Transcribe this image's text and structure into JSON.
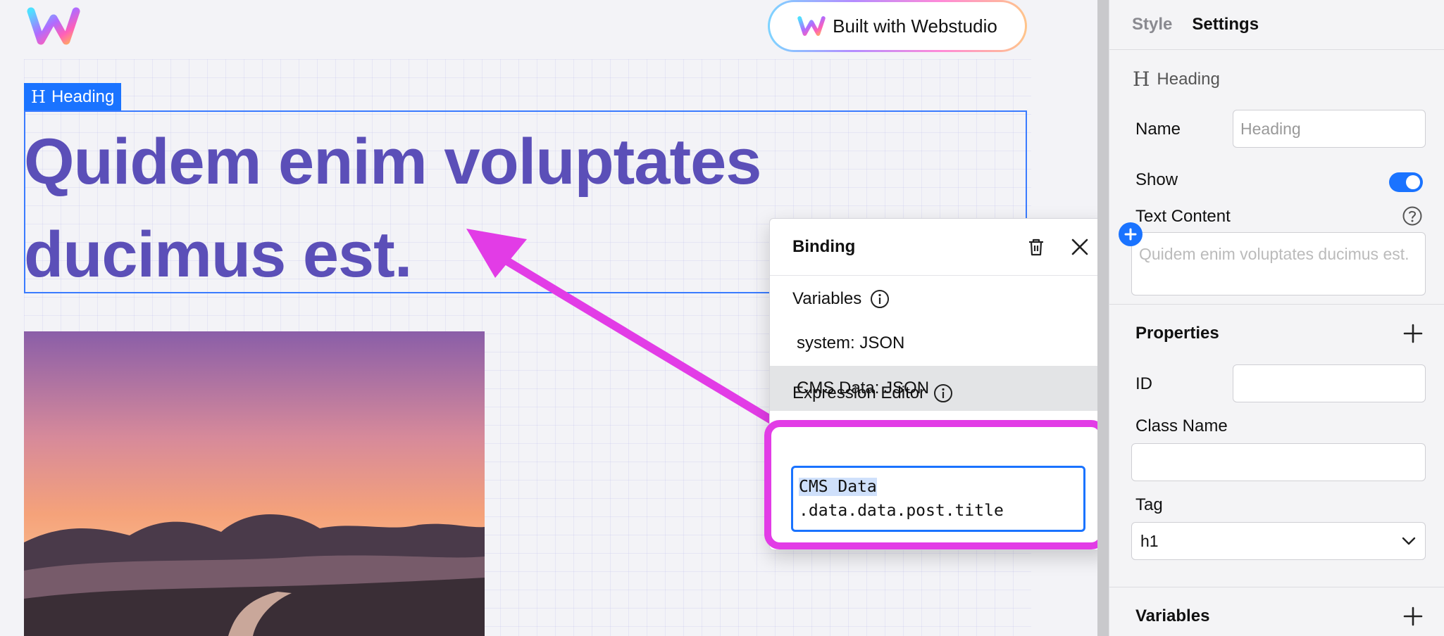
{
  "canvas": {
    "built_with_label": "Built with Webstudio",
    "heading_tag_label": "Heading",
    "heading_text": "Quidem enim voluptates ducimus est."
  },
  "binding": {
    "title": "Binding",
    "variables_label": "Variables",
    "variables": [
      {
        "label": "system: JSON",
        "selected": false
      },
      {
        "label": "CMS Data: JSON",
        "selected": true
      }
    ],
    "expression_label": "Expression Editor",
    "expression_highlight": "CMS Data",
    "expression_rest": ".data.data.post.title"
  },
  "panel": {
    "tabs": [
      {
        "label": "Style",
        "active": false
      },
      {
        "label": "Settings",
        "active": true
      }
    ],
    "component_name": "Heading",
    "name_label": "Name",
    "name_placeholder": "Heading",
    "show_label": "Show",
    "show_on": true,
    "text_content_label": "Text Content",
    "text_content_value": "Quidem enim voluptates ducimus est.",
    "properties_title": "Properties",
    "id_label": "ID",
    "id_value": "",
    "class_label": "Class Name",
    "class_value": "",
    "tag_label": "Tag",
    "tag_value": "h1",
    "variables_title": "Variables"
  },
  "colors": {
    "accent": "#1a73ff",
    "heading": "#5b4fb8",
    "annotation": "#e23ce6"
  }
}
